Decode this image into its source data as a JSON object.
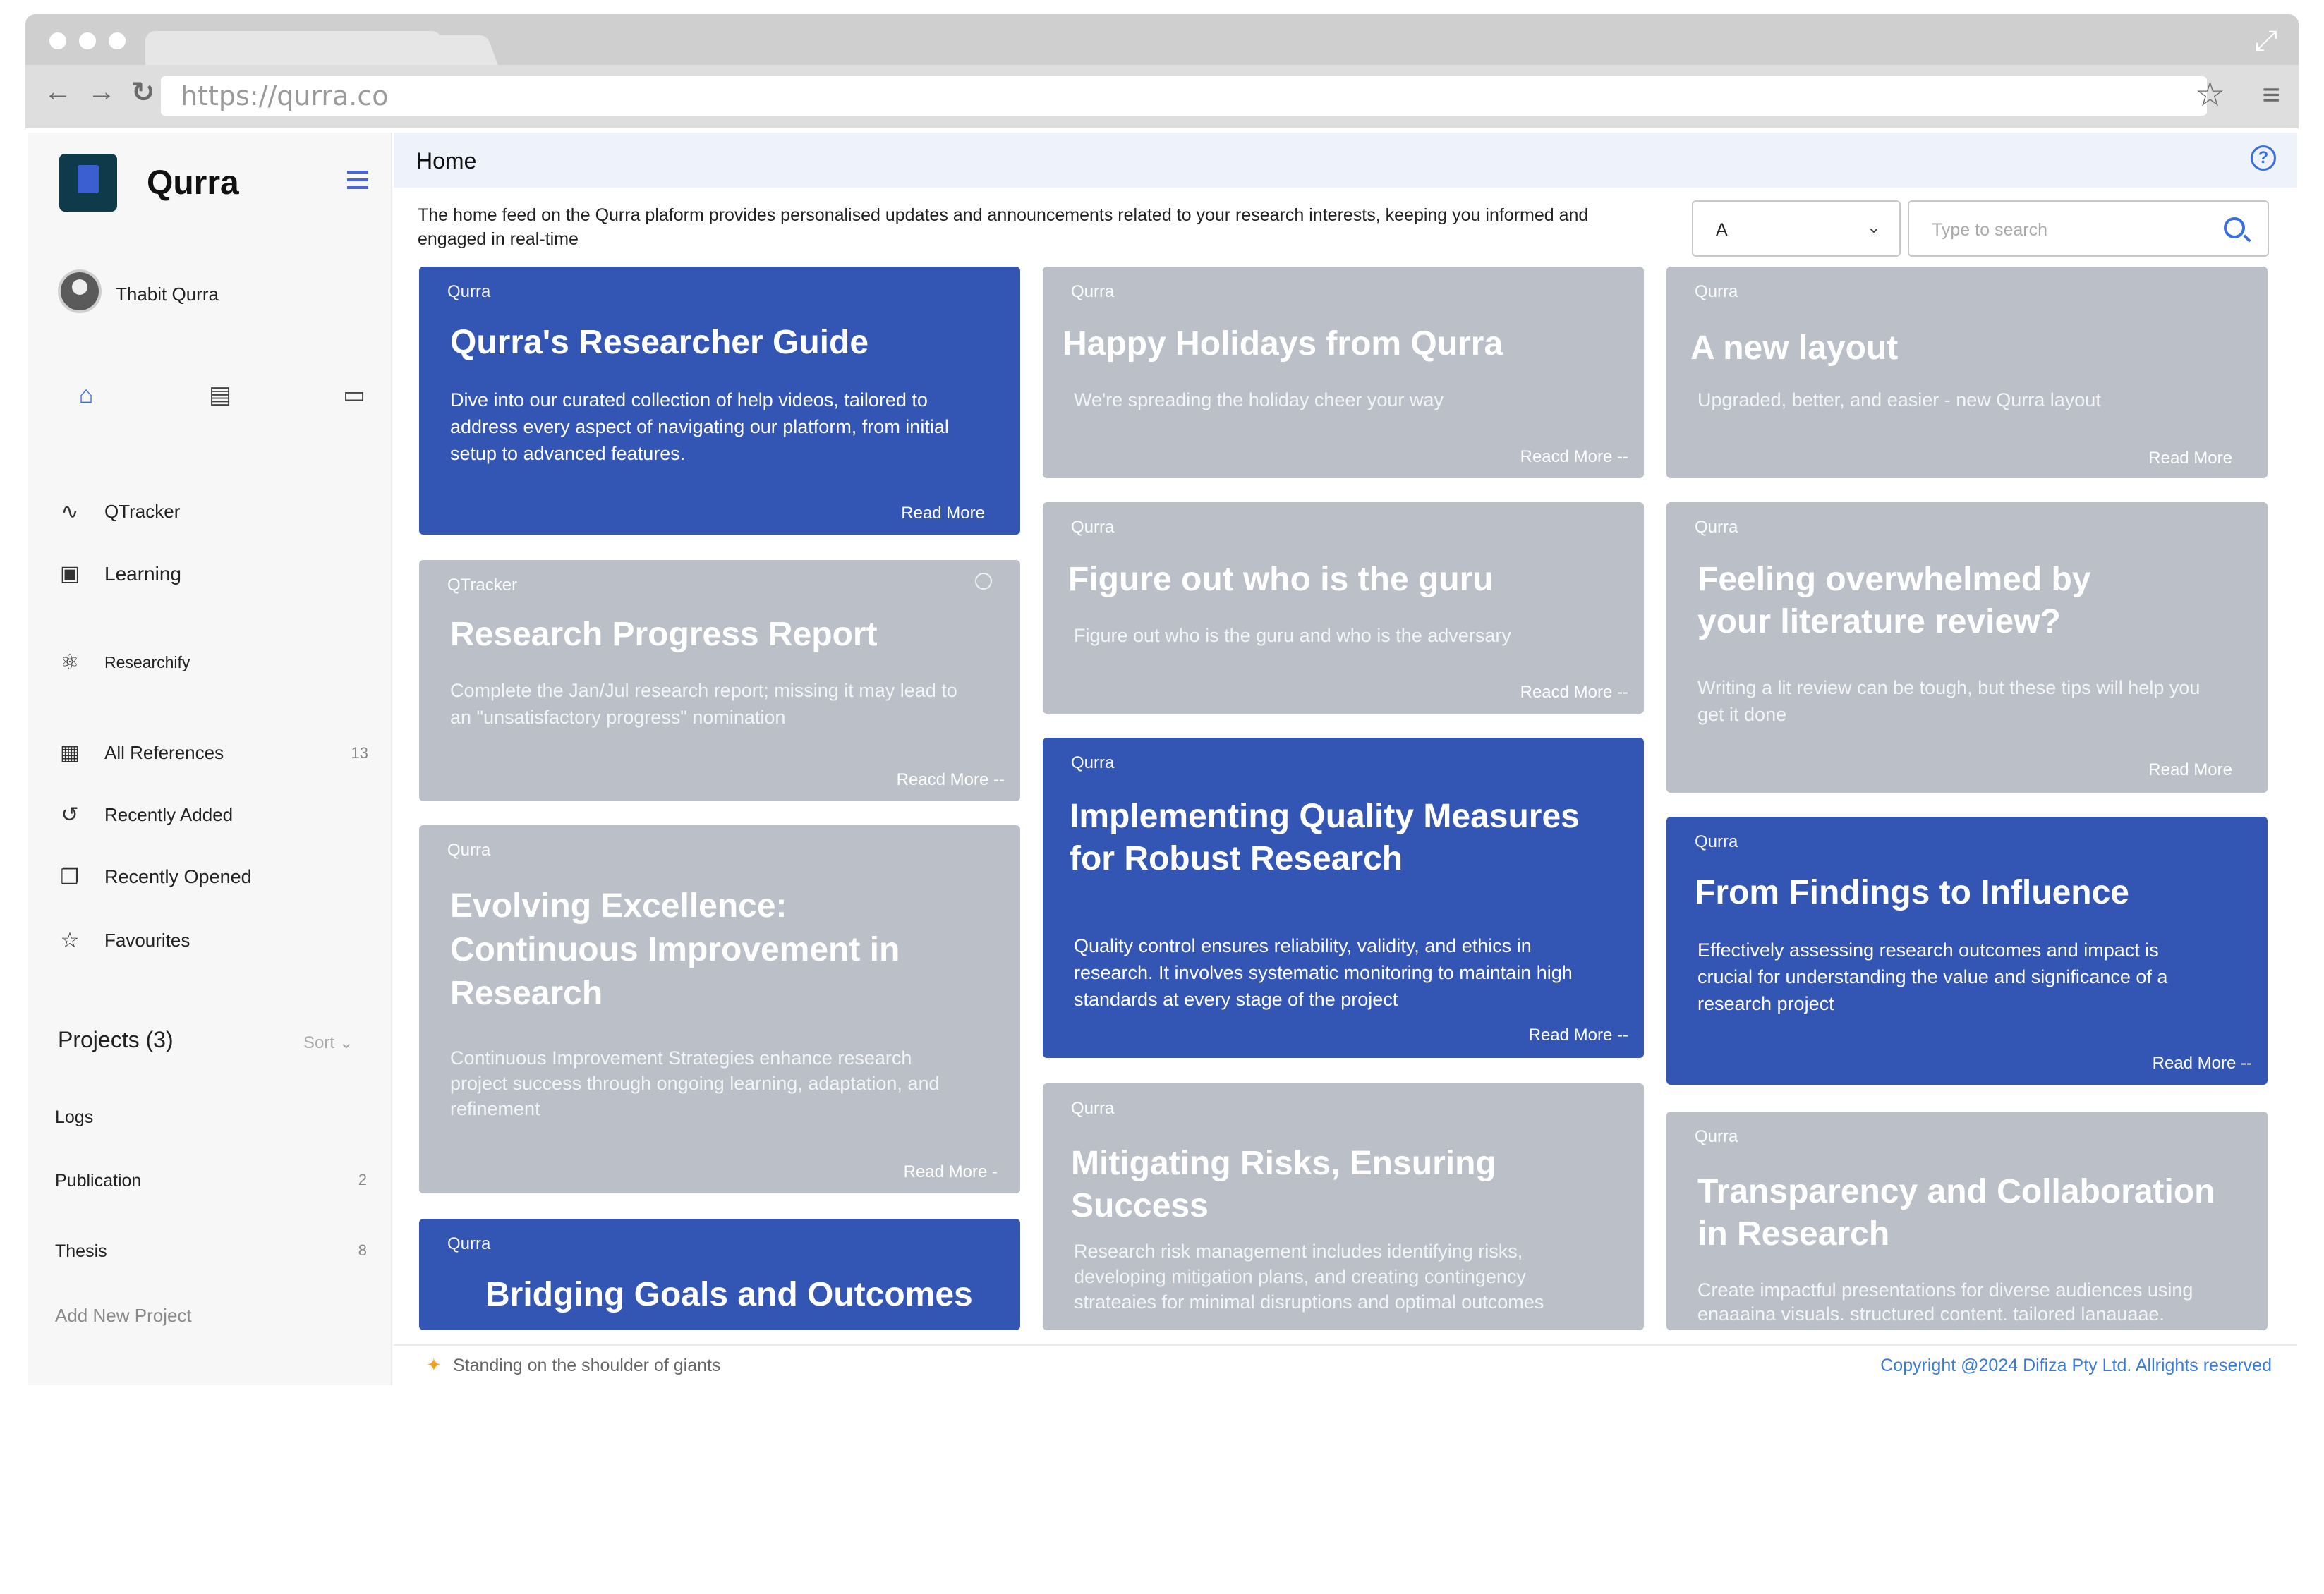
{
  "browser": {
    "url": "https://qurra.co"
  },
  "sidebar": {
    "brand": "Qurra",
    "user_name": "Thabit Qurra",
    "quick_icons": [
      "home-icon",
      "book-icon",
      "chat-icon"
    ],
    "items": [
      {
        "label": "QTracker",
        "icon": "wave-icon"
      },
      {
        "label": "Learning",
        "icon": "presentation-icon"
      },
      {
        "label": "Researchify",
        "icon": "atom-icon"
      },
      {
        "label": "All References",
        "icon": "references-icon",
        "count": "13"
      },
      {
        "label": "Recently Added",
        "icon": "history-icon"
      },
      {
        "label": "Recently Opened",
        "icon": "copy-icon"
      },
      {
        "label": "Favourites",
        "icon": "star-icon"
      }
    ],
    "projects_title": "Projects (3)",
    "sort_label": "Sort",
    "projects": [
      {
        "label": "Logs",
        "count": ""
      },
      {
        "label": "Publication",
        "count": "2"
      },
      {
        "label": "Thesis",
        "count": "8"
      }
    ],
    "add_project": "Add New Project"
  },
  "header": {
    "title": "Home"
  },
  "main": {
    "intro": "The home feed on the Qurra plaform provides personalised updates and announcements related to your research interests, keeping you informed and engaged in real-time",
    "filter_value": "A",
    "search_placeholder": "Type to search",
    "cards": [
      {
        "tag": "Qurra",
        "title": "Qurra's Researcher Guide",
        "desc": "Dive into our curated collection of help videos, tailored to address every aspect of navigating our platform, from initial setup to advanced features.",
        "more": "Read More"
      },
      {
        "tag": "Qurra",
        "title": "Happy Holidays from Qurra",
        "desc": "We're spreading the holiday cheer your way",
        "more": "Reacd More --"
      },
      {
        "tag": "Qurra",
        "title": "A new layout",
        "desc": "Upgraded, better, and easier - new Qurra layout",
        "more": "Read More"
      },
      {
        "tag": "QTracker",
        "title": "Research Progress Report",
        "desc": "Complete the Jan/Jul research report; missing it may lead to an \"unsatisfactory progress\" nomination",
        "more": "Reacd More --"
      },
      {
        "tag": "Qurra",
        "title": "Figure out who is the guru",
        "desc": "Figure out who is the guru and who is the adversary",
        "more": "Reacd More --"
      },
      {
        "tag": "Qurra",
        "title": "Feeling overwhelmed by your literature review?",
        "desc": "Writing a lit review can be tough, but these tips will help you get it done",
        "more": "Read More"
      },
      {
        "tag": "Qurra",
        "title": "Evolving Excellence: Continuous Improvement in Research",
        "desc": "Continuous Improvement Strategies enhance research project success through ongoing learning, adaptation, and refinement",
        "more": "Read More -"
      },
      {
        "tag": "Qurra",
        "title": "Implementing Quality Measures for Robust Research",
        "desc": "Quality control ensures reliability, validity, and ethics in research. It involves systematic monitoring to maintain high standards at every stage of the project",
        "more": "Read More --"
      },
      {
        "tag": "Qurra",
        "title": "From Findings to Influence",
        "desc": "Effectively assessing research outcomes and impact is crucial for understanding the value and significance of a research project",
        "more": "Read More --"
      },
      {
        "tag": "Qurra",
        "title": "Mitigating Risks, Ensuring Success",
        "desc": "Research risk management includes identifying risks, developing mitigation plans, and creating contingency strateaies for minimal disruptions and optimal outcomes",
        "more": ""
      },
      {
        "tag": "Qurra",
        "title": "Bridging Goals and Outcomes",
        "desc": "",
        "more": ""
      },
      {
        "tag": "Qurra",
        "title": "Transparency and Collaboration in Research",
        "desc": "Create impactful presentations for diverse audiences using enaaaina visuals. structured content. tailored lanauaae.",
        "more": ""
      }
    ]
  },
  "footer": {
    "tagline": "Standing on the shoulder of giants",
    "copyright": "Copyright @2024 Difiza Pty Ltd. Allrights reserved"
  },
  "colors": {
    "card_blue": "#3356b5",
    "card_grey": "#bbbfc7",
    "accent": "#3a6fe0"
  }
}
